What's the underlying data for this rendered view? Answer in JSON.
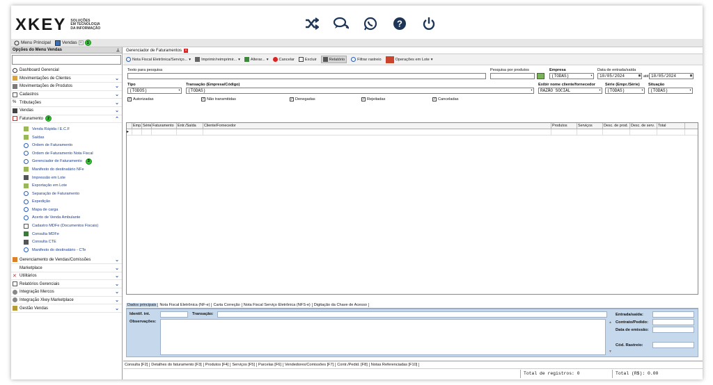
{
  "brand": {
    "logo": "XKEY",
    "tagline": [
      "SOLUÇÕES",
      "EM TECNOLOGIA",
      "DA INFORMAÇÃO"
    ]
  },
  "header": {
    "icons": [
      "shuffle-icon",
      "chat-icon",
      "whatsapp-icon",
      "help-icon",
      "power-icon"
    ]
  },
  "tabs": {
    "menu_principal": "Menu Principal",
    "vendas": "Vendas",
    "badge1": "1"
  },
  "sidebar": {
    "title": "Opções do Menu Vendas",
    "groups_top": [
      {
        "label": "Dashboard Gerencial"
      },
      {
        "label": "Movimentações de Clientes"
      },
      {
        "label": "Movimentações de Produtos"
      },
      {
        "label": "Cadastros"
      },
      {
        "label": "Tributações"
      },
      {
        "label": "Vendas"
      },
      {
        "label": "Faturamento"
      }
    ],
    "faturamento_badge": "2",
    "items": [
      "Venda Rápida / E.C.F",
      "Saídas",
      "Ordem de Faturamento",
      "Ordem de Faturamento Nota Fiscal",
      "Gerenciador de Faturamento",
      "Manifesto do destinatário NFe",
      "Impressão em Lote",
      "Exportação em Lote",
      "Separação de Faturamento",
      "Expedição",
      "Mapa de carga",
      "Acerto de Venda Ambulante",
      "Cadastro MDFe (Documentos Fiscais)",
      "Consulta MDFe",
      "Consulta CTE",
      "Manifesto do destinatário - CTe"
    ],
    "gerenciador_badge": "3",
    "groups_bottom": [
      {
        "label": "Gerenciamento de Vendas/Comissões"
      },
      {
        "label": "Marketplace"
      },
      {
        "label": "Utilitários"
      },
      {
        "label": "Relatórios Gerenciais"
      },
      {
        "label": "Integração Mercos"
      },
      {
        "label": "Integração Xkey Marketplace"
      },
      {
        "label": "Gestão Vendas"
      }
    ]
  },
  "content": {
    "tab_title": "Gerenciador de Faturamentos",
    "toolbar": {
      "nf": "Nota Fiscal Eletrônica/Serviço...",
      "imprimir": "Imprimir/reimprimir...",
      "alterar": "Alterar...",
      "cancelar": "Cancelar",
      "excluir": "Excluir",
      "relatorio": "Relatório",
      "filtrar": "Filtrar rastreio",
      "operacoes": "Operações em Lote"
    },
    "form": {
      "texto_label": "Texto para pesquisa",
      "pesquisa_label": "Pesquisa por produtos",
      "empresa_label": "Empresa",
      "empresa_value": "(TODAS)",
      "data_label": "Data de entrada/saída",
      "data_de": "10/05/2024",
      "ate": "até",
      "data_ate": "10/05/2024",
      "tipo_label": "Tipo",
      "tipo_value": "(TODOS)",
      "transacao_label": "Transação (Empresa/Código)",
      "transacao_value": "(TODAS)",
      "exibir_label": "Exibir nome cliente/fornecedor",
      "exibir_value": "RAZÃO SOCIAL",
      "serie_label": "Série (Empr./Série)",
      "serie_value": "(TODAS)",
      "situacao_label": "Situação",
      "situacao_value": "(TODAS)",
      "checks": [
        "Autorizadas",
        "Não transmitidas",
        "Denegadas",
        "Rejeitadas",
        "Canceladas"
      ]
    },
    "grid_headers": [
      "Emp.",
      "Série",
      "Faturamento",
      "Entr./Saída",
      "Cliente/Fornecedor",
      "Produtos",
      "Serviços",
      "Desc. de prod.",
      "Desc. de serv.",
      "Total"
    ],
    "detail_tabs": [
      "Dados principais",
      "Nota Fiscal Eletrônica (NF-e)",
      "Carta Correção",
      "Nota Fiscal Serviço Eletrônica (NFS-e)",
      "Digitação da Chave de Acesso"
    ],
    "detail": {
      "identif": "Identif. int.",
      "transacao": "Transação:",
      "observacoes": "Observações:",
      "entrada": "Entrada/saída:",
      "contrato": "Contrato/Pedido:",
      "emissao": "Data de emissão:",
      "rastreio": "Cód. Rastreio:"
    },
    "bottom_tabs": [
      "Consulta [F2]",
      "Detalhes do faturamento [F3]",
      "Produtos [F4]",
      "Serviços [F5]",
      "Parcelas [F6]",
      "Vendedores/Comissões [F7]",
      "Contr./Pedid. [F8]",
      "Notas Referenciadas [F10]"
    ],
    "status": {
      "total_registros": "Total de registros: 0",
      "total_rs": "Total (R$): 0.00"
    }
  }
}
